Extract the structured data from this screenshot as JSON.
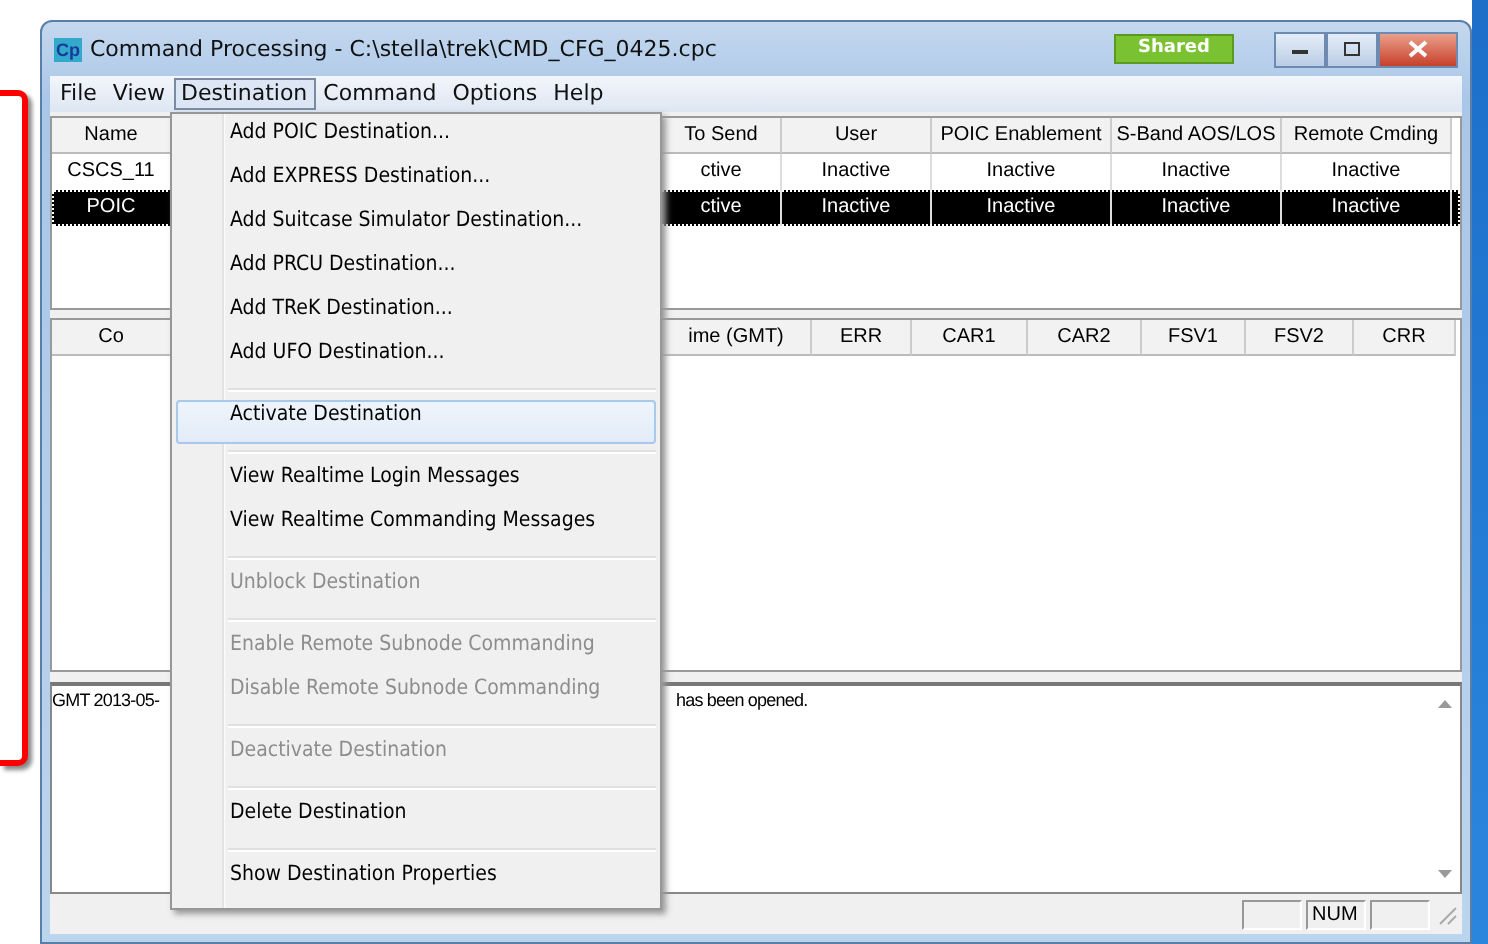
{
  "window": {
    "title": "Command Processing - C:\\stella\\trek\\CMD_CFG_0425.cpc",
    "icon_text": "Cp",
    "badge": "Shared"
  },
  "menu_bar": [
    {
      "label": "File",
      "selected": false
    },
    {
      "label": "View",
      "selected": false
    },
    {
      "label": "Destination",
      "selected": true
    },
    {
      "label": "Command",
      "selected": false
    },
    {
      "label": "Options",
      "selected": false
    },
    {
      "label": "Help",
      "selected": false
    }
  ],
  "destinations_table": {
    "columns": [
      "Name",
      "To Send",
      "User",
      "POIC Enablement",
      "S-Band AOS/LOS",
      "Remote Cmding"
    ],
    "rows": [
      {
        "cells": [
          "CSCS_11",
          "ctive",
          "Inactive",
          "Inactive",
          "Inactive",
          "Inactive"
        ],
        "selected": false
      },
      {
        "cells": [
          "POIC",
          "ctive",
          "Inactive",
          "Inactive",
          "Inactive",
          "Inactive"
        ],
        "selected": true
      }
    ]
  },
  "commands_table": {
    "columns": [
      "Co",
      "ime (GMT)",
      "ERR",
      "CAR1",
      "CAR2",
      "FSV1",
      "FSV2",
      "CRR"
    ]
  },
  "log": {
    "fragments": [
      "GMT 2013-05-",
      "has been opened."
    ]
  },
  "status_bar": {
    "panes": [
      "NUM"
    ]
  },
  "destination_menu": [
    {
      "kind": "item",
      "label": "Add POIC Destination...",
      "disabled": false,
      "selected": false
    },
    {
      "kind": "item",
      "label": "Add EXPRESS Destination...",
      "disabled": false,
      "selected": false
    },
    {
      "kind": "item",
      "label": "Add Suitcase Simulator Destination...",
      "disabled": false,
      "selected": false
    },
    {
      "kind": "item",
      "label": "Add PRCU Destination...",
      "disabled": false,
      "selected": false
    },
    {
      "kind": "item",
      "label": "Add TReK Destination...",
      "disabled": false,
      "selected": false
    },
    {
      "kind": "item",
      "label": "Add UFO Destination...",
      "disabled": false,
      "selected": false
    },
    {
      "kind": "separator"
    },
    {
      "kind": "item",
      "label": "Activate Destination",
      "disabled": false,
      "selected": true
    },
    {
      "kind": "separator"
    },
    {
      "kind": "item",
      "label": "View Realtime Login Messages",
      "disabled": false,
      "selected": false
    },
    {
      "kind": "item",
      "label": "View Realtime Commanding Messages",
      "disabled": false,
      "selected": false
    },
    {
      "kind": "separator"
    },
    {
      "kind": "item",
      "label": "Unblock Destination",
      "disabled": true,
      "selected": false
    },
    {
      "kind": "separator"
    },
    {
      "kind": "item",
      "label": "Enable Remote Subnode Commanding",
      "disabled": true,
      "selected": false
    },
    {
      "kind": "item",
      "label": "Disable Remote Subnode Commanding",
      "disabled": true,
      "selected": false
    },
    {
      "kind": "separator"
    },
    {
      "kind": "item",
      "label": "Deactivate Destination",
      "disabled": true,
      "selected": false
    },
    {
      "kind": "separator"
    },
    {
      "kind": "item",
      "label": "Delete Destination",
      "disabled": false,
      "selected": false
    },
    {
      "kind": "separator"
    },
    {
      "kind": "item",
      "label": "Show Destination Properties",
      "disabled": false,
      "selected": false
    }
  ]
}
